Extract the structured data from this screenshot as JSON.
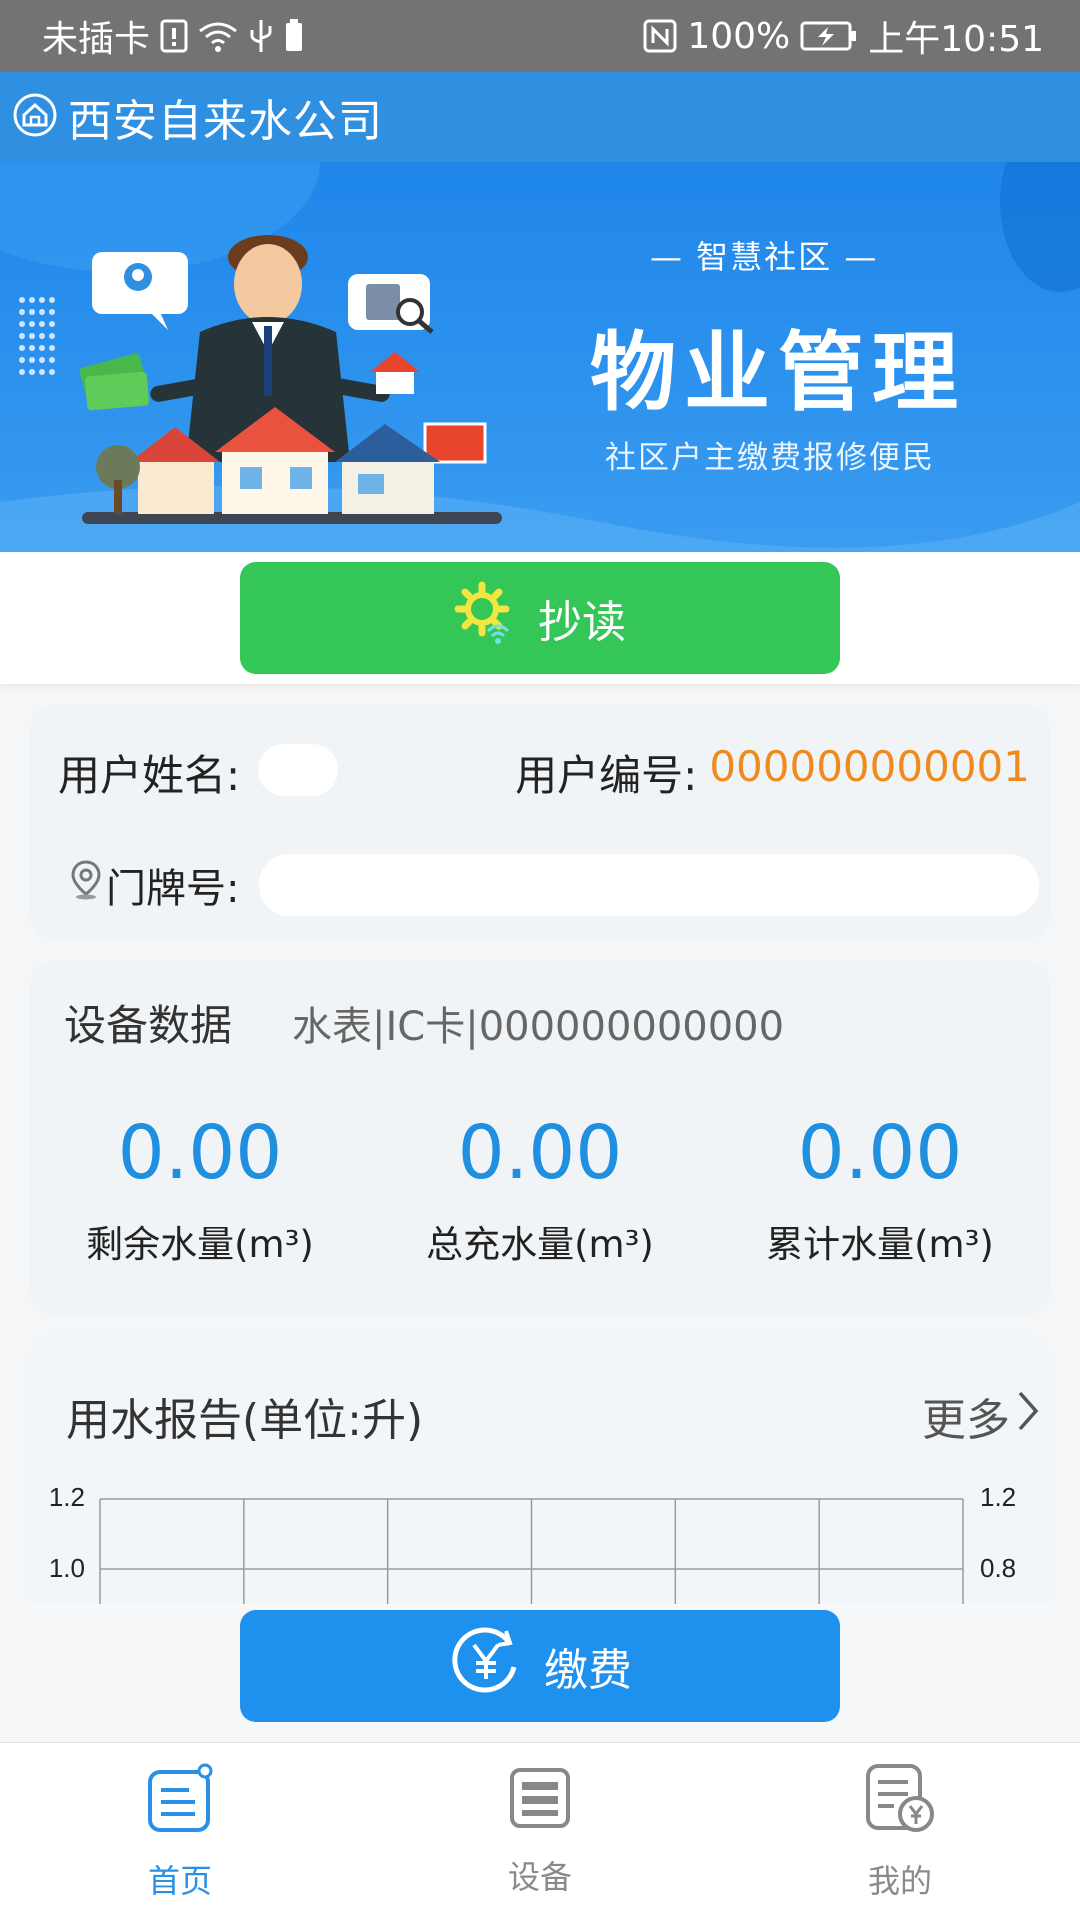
{
  "status_bar": {
    "carrier": "未插卡",
    "battery": "100%",
    "time": "上午10:51"
  },
  "header": {
    "title": "西安自来水公司",
    "icon": "home-icon"
  },
  "banner": {
    "subtitle_top": "— 智慧社区 —",
    "title": "物业管理",
    "subtitle_bottom": "社区户主缴费报修便民"
  },
  "read_button": {
    "label": "抄读",
    "icon": "gear-wifi-icon"
  },
  "user": {
    "name_label": "用户姓名:",
    "id_label": "用户编号:",
    "id_value": "000000000001",
    "address_label": "门牌号:"
  },
  "device": {
    "title": "设备数据",
    "info": "水表|IC卡|000000000000",
    "stats": [
      {
        "value": "0.00",
        "label": "剩余水量(m³)"
      },
      {
        "value": "0.00",
        "label": "总充水量(m³)"
      },
      {
        "value": "0.00",
        "label": "累计水量(m³)"
      }
    ]
  },
  "report": {
    "title": "用水报告(单位:升)",
    "more_label": "更多"
  },
  "chart_data": {
    "type": "line",
    "title": "用水报告(单位:升)",
    "left_axis_ticks": [
      "1.2",
      "1.0"
    ],
    "right_axis_ticks": [
      "1.2",
      "0.8"
    ],
    "columns": 6,
    "series": []
  },
  "pay_button": {
    "label": "缴费",
    "icon": "yen-circle-icon"
  },
  "bottom_nav": {
    "items": [
      {
        "label": "首页",
        "icon": "home-doc-icon",
        "active": true
      },
      {
        "label": "设备",
        "icon": "device-icon",
        "active": false
      },
      {
        "label": "我的",
        "icon": "bill-yen-icon",
        "active": false
      }
    ]
  },
  "colors": {
    "primary_blue": "#2f8fe0",
    "read_green": "#35c658",
    "pay_blue": "#1e90ee",
    "accent_orange": "#f08a1c",
    "stat_blue": "#1f8fe0"
  }
}
